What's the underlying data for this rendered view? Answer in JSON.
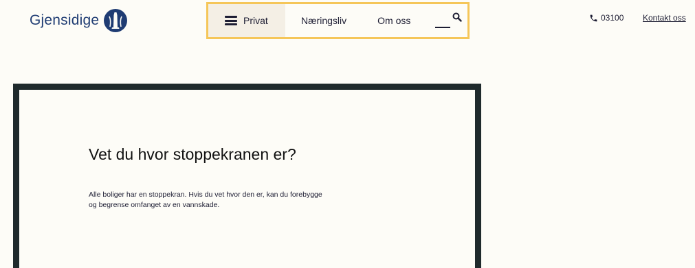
{
  "header": {
    "logo": {
      "text": "Gjensidige",
      "icon": "gjensidige-lighthouse-icon",
      "color": "#1f3c73"
    },
    "nav": {
      "highlight_color": "#f5c659",
      "items": [
        {
          "label": "Privat",
          "icon": "menu-icon",
          "active": true
        },
        {
          "label": "Næringsliv"
        },
        {
          "label": "Om oss"
        }
      ],
      "search_icon": "search-icon"
    },
    "phone": {
      "icon": "phone-icon",
      "number": "03100"
    },
    "contact_label": "Kontakt oss"
  },
  "card": {
    "title": "Vet du hvor stoppekranen er?",
    "text": "Alle boliger har en stoppekran. Hvis du vet hvor den er, kan du forebygge og begrense omfanget av en vannskade.",
    "border_color": "#1f2a2c"
  }
}
